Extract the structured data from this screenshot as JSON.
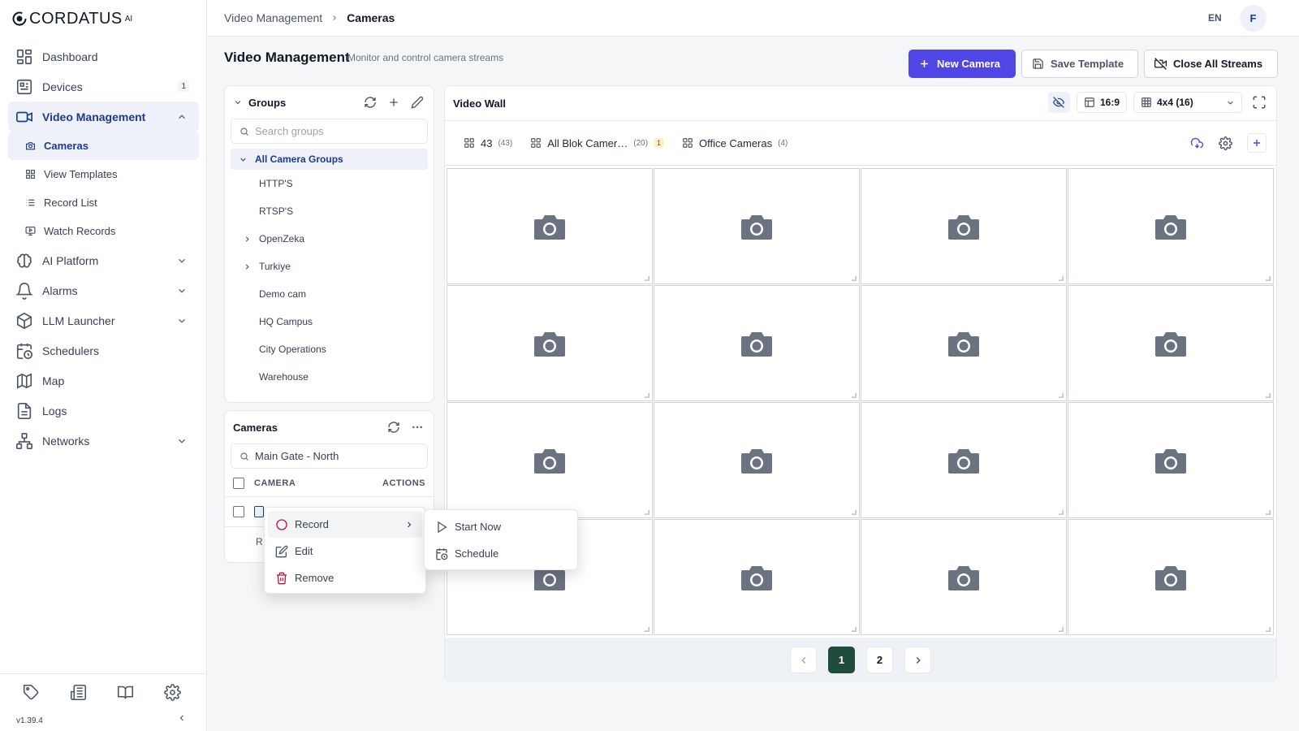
{
  "brand": {
    "name": "CORDATUS",
    "sup": "AI"
  },
  "sidebar": {
    "items": [
      {
        "label": "Dashboard",
        "icon": "dashboard-icon"
      },
      {
        "label": "Devices",
        "icon": "devices-icon",
        "badge": "1"
      },
      {
        "label": "Video Management",
        "icon": "video-icon",
        "expanded": true
      },
      {
        "label": "AI Platform",
        "icon": "brain-icon"
      },
      {
        "label": "Alarms",
        "icon": "bell-icon"
      },
      {
        "label": "LLM Launcher",
        "icon": "cube-icon"
      },
      {
        "label": "Schedulers",
        "icon": "calendar-clock-icon"
      },
      {
        "label": "Map",
        "icon": "map-icon"
      },
      {
        "label": "Logs",
        "icon": "file-text-icon"
      },
      {
        "label": "Networks",
        "icon": "network-icon"
      }
    ],
    "sub_items": [
      {
        "label": "Cameras",
        "icon": "camera-icon",
        "active": true
      },
      {
        "label": "View Templates",
        "icon": "grid-icon"
      },
      {
        "label": "Record List",
        "icon": "list-icon"
      },
      {
        "label": "Watch Records",
        "icon": "monitor-play-icon"
      }
    ],
    "version": "v1.39.4"
  },
  "header": {
    "breadcrumb": [
      "Video Management",
      "Cameras"
    ],
    "lang": "EN",
    "avatar": "F"
  },
  "page": {
    "title": "Video Management",
    "subtitle": "Monitor and control camera streams",
    "new_camera": "New Camera",
    "save_template": "Save Template",
    "close_streams": "Close All Streams"
  },
  "groups": {
    "title": "Groups",
    "search_placeholder": "Search groups",
    "all": "All Camera Groups",
    "items": [
      {
        "label": "HTTP'S",
        "expandable": false
      },
      {
        "label": "RTSP'S",
        "expandable": false
      },
      {
        "label": "OpenZeka",
        "expandable": true
      },
      {
        "label": "Turkiye",
        "expandable": true
      },
      {
        "label": "Demo cam",
        "expandable": false
      },
      {
        "label": "HQ Campus",
        "expandable": false
      },
      {
        "label": "City Operations",
        "expandable": false
      },
      {
        "label": "Warehouse",
        "expandable": false
      }
    ]
  },
  "cameras": {
    "title": "Cameras",
    "search_value": "Main Gate - North",
    "col_camera": "CAMERA",
    "col_actions": "ACTIONS",
    "footer_text": "R"
  },
  "wall": {
    "title": "Video Wall",
    "aspect": "16:9",
    "grid": "4x4 (16)",
    "tabs": [
      {
        "label": "43",
        "count": "(43)"
      },
      {
        "label": "All Blok Camer…",
        "count": "(20)",
        "badge": "1"
      },
      {
        "label": "Office Cameras",
        "count": "(4)"
      }
    ],
    "tile_count": 16,
    "pages": [
      "1",
      "2"
    ],
    "current_page": "1"
  },
  "context_menu": {
    "items": [
      "Record",
      "Edit",
      "Remove"
    ],
    "submenu": [
      "Start Now",
      "Schedule"
    ]
  },
  "colors": {
    "accent": "#4f46e5",
    "active_bg": "#eef0fa",
    "active_text": "#1e3a8a",
    "page_active": "#1f4d3a",
    "danger": "#be123c"
  }
}
